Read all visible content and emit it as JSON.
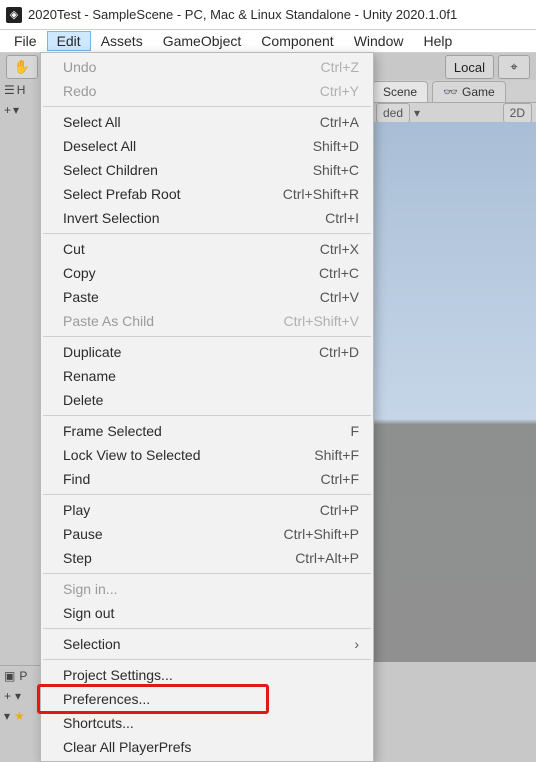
{
  "titlebar": {
    "icon_glyph": "◈",
    "title": "2020Test - SampleScene - PC, Mac & Linux Standalone - Unity 2020.1.0f1"
  },
  "menubar": {
    "items": [
      {
        "label": "File"
      },
      {
        "label": "Edit"
      },
      {
        "label": "Assets"
      },
      {
        "label": "GameObject"
      },
      {
        "label": "Component"
      },
      {
        "label": "Window"
      },
      {
        "label": "Help"
      }
    ],
    "active_index": 1
  },
  "toolbar": {
    "hand_icon": "✋",
    "local_label": "Local",
    "magnet_icon": "⌖"
  },
  "tabs": {
    "hierarchy_label": "H",
    "scene_label": "Scene",
    "game_label": "Game",
    "game_icon": "👓"
  },
  "panel": {
    "plus": "+",
    "caret": "▾",
    "shaded": "ded",
    "mode_2d": "2D",
    "dropdown_caret": "▾"
  },
  "bottom": {
    "project_label": "P",
    "folder_icon": "▣",
    "star_icon": "★",
    "tri_icon": "▾"
  },
  "edit_menu": {
    "items": [
      {
        "label": "Undo",
        "shortcut": "Ctrl+Z",
        "disabled": true
      },
      {
        "label": "Redo",
        "shortcut": "Ctrl+Y",
        "disabled": true
      },
      {
        "sep": true
      },
      {
        "label": "Select All",
        "shortcut": "Ctrl+A"
      },
      {
        "label": "Deselect All",
        "shortcut": "Shift+D"
      },
      {
        "label": "Select Children",
        "shortcut": "Shift+C"
      },
      {
        "label": "Select Prefab Root",
        "shortcut": "Ctrl+Shift+R"
      },
      {
        "label": "Invert Selection",
        "shortcut": "Ctrl+I"
      },
      {
        "sep": true
      },
      {
        "label": "Cut",
        "shortcut": "Ctrl+X"
      },
      {
        "label": "Copy",
        "shortcut": "Ctrl+C"
      },
      {
        "label": "Paste",
        "shortcut": "Ctrl+V"
      },
      {
        "label": "Paste As Child",
        "shortcut": "Ctrl+Shift+V",
        "disabled": true
      },
      {
        "sep": true
      },
      {
        "label": "Duplicate",
        "shortcut": "Ctrl+D"
      },
      {
        "label": "Rename",
        "shortcut": ""
      },
      {
        "label": "Delete",
        "shortcut": ""
      },
      {
        "sep": true
      },
      {
        "label": "Frame Selected",
        "shortcut": "F"
      },
      {
        "label": "Lock View to Selected",
        "shortcut": "Shift+F"
      },
      {
        "label": "Find",
        "shortcut": "Ctrl+F"
      },
      {
        "sep": true
      },
      {
        "label": "Play",
        "shortcut": "Ctrl+P"
      },
      {
        "label": "Pause",
        "shortcut": "Ctrl+Shift+P"
      },
      {
        "label": "Step",
        "shortcut": "Ctrl+Alt+P"
      },
      {
        "sep": true
      },
      {
        "label": "Sign in...",
        "shortcut": "",
        "disabled": true
      },
      {
        "label": "Sign out",
        "shortcut": ""
      },
      {
        "sep": true
      },
      {
        "label": "Selection",
        "shortcut": "",
        "submenu": true
      },
      {
        "sep": true
      },
      {
        "label": "Project Settings...",
        "shortcut": ""
      },
      {
        "label": "Preferences...",
        "shortcut": "",
        "highlighted": true
      },
      {
        "label": "Shortcuts...",
        "shortcut": ""
      },
      {
        "label": "Clear All PlayerPrefs",
        "shortcut": ""
      }
    ]
  }
}
